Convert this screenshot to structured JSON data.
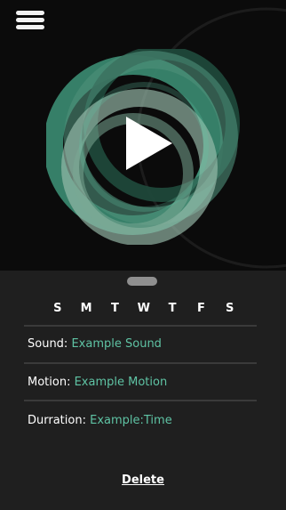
{
  "app": {
    "menu_icon": "hamburger-icon",
    "play_icon": "play-icon",
    "accent_color": "#5fc3a4",
    "background_color": "#111111",
    "sheet_color": "#1f1f1f"
  },
  "schedule": {
    "days": [
      "S",
      "M",
      "T",
      "W",
      "T",
      "F",
      "S"
    ]
  },
  "details": {
    "sound_label": "Sound:",
    "sound_value": "Example Sound",
    "motion_label": "Motion:",
    "motion_value": "Example Motion",
    "duration_label": "Durration:",
    "duration_value": "Example:Time"
  },
  "actions": {
    "delete_label": "Delete"
  }
}
